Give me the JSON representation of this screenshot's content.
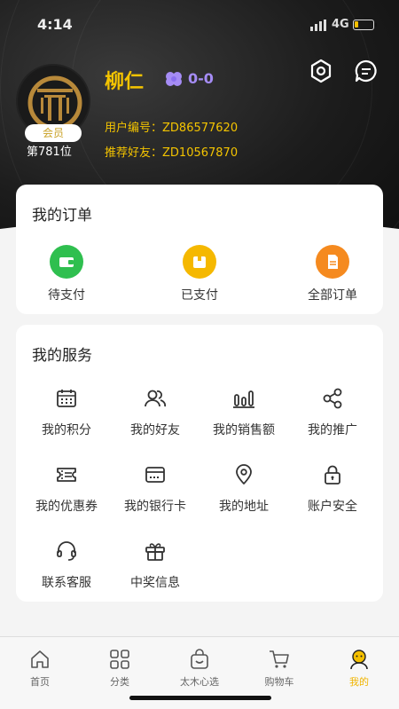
{
  "status_bar": {
    "time": "4:14",
    "network": "4G"
  },
  "profile": {
    "name": "柳仁",
    "level_value": "0-0",
    "member_badge": "会员",
    "rank": "第781位",
    "user_id_label": "用户编号：",
    "user_id": "ZD86577620",
    "referrer_label": "推荐好友：",
    "referrer_id": "ZD10567870"
  },
  "orders": {
    "title": "我的订单",
    "items": [
      {
        "label": "待支付",
        "icon": "wallet-icon",
        "color": "#2fbf4f"
      },
      {
        "label": "已支付",
        "icon": "paid-box-icon",
        "color": "#f5b800"
      },
      {
        "label": "全部订单",
        "icon": "document-icon",
        "color": "#f58a1f"
      }
    ]
  },
  "services": {
    "title": "我的服务",
    "items": [
      {
        "label": "我的积分",
        "icon": "calendar-icon"
      },
      {
        "label": "我的好友",
        "icon": "friends-icon"
      },
      {
        "label": "我的销售额",
        "icon": "bar-chart-icon"
      },
      {
        "label": "我的推广",
        "icon": "share-icon"
      },
      {
        "label": "我的优惠券",
        "icon": "coupon-icon"
      },
      {
        "label": "我的银行卡",
        "icon": "bank-card-icon"
      },
      {
        "label": "我的地址",
        "icon": "location-icon"
      },
      {
        "label": "账户安全",
        "icon": "lock-icon"
      },
      {
        "label": "联系客服",
        "icon": "headset-icon"
      },
      {
        "label": "中奖信息",
        "icon": "gift-icon"
      }
    ]
  },
  "tabbar": {
    "items": [
      {
        "label": "首页",
        "icon": "home-icon"
      },
      {
        "label": "分类",
        "icon": "grid-icon"
      },
      {
        "label": "太木心选",
        "icon": "bag-icon"
      },
      {
        "label": "购物车",
        "icon": "cart-icon"
      },
      {
        "label": "我的",
        "icon": "profile-icon",
        "active": true
      }
    ]
  },
  "colors": {
    "accent": "#f4c400",
    "header_bg": "#1c1c1c",
    "level": "#a58cf5"
  }
}
